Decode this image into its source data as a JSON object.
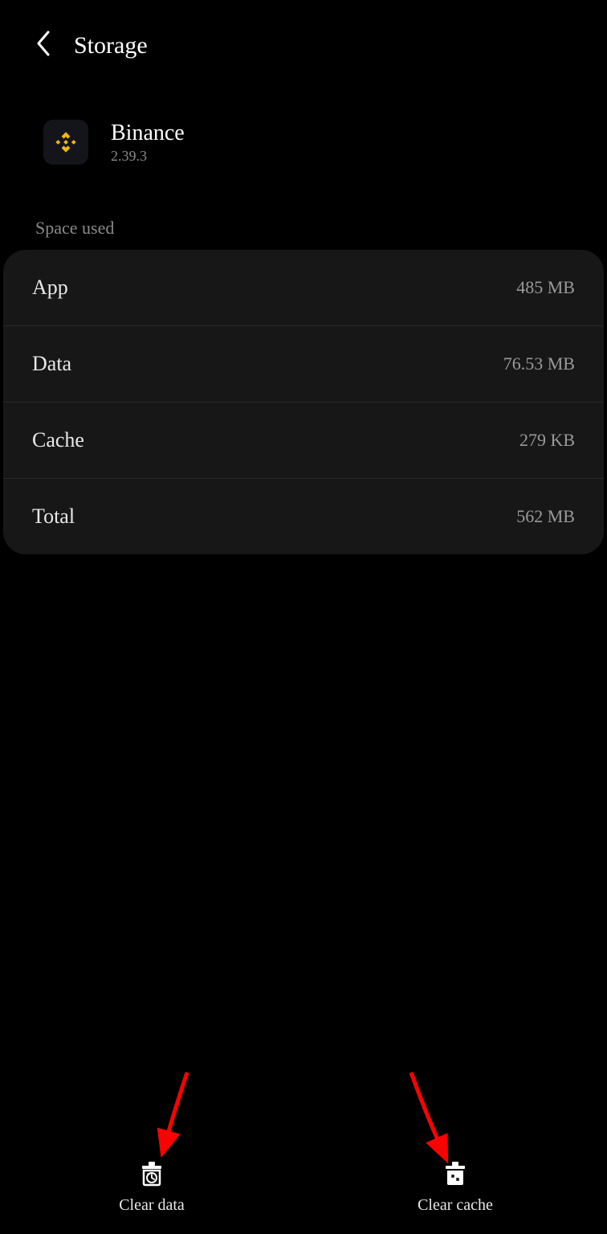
{
  "header": {
    "title": "Storage"
  },
  "app": {
    "name": "Binance",
    "version": "2.39.3"
  },
  "section": {
    "label": "Space used"
  },
  "storage": {
    "app": {
      "label": "App",
      "value": "485 MB"
    },
    "data": {
      "label": "Data",
      "value": "76.53 MB"
    },
    "cache": {
      "label": "Cache",
      "value": "279 KB"
    },
    "total": {
      "label": "Total",
      "value": "562 MB"
    }
  },
  "actions": {
    "clearData": "Clear data",
    "clearCache": "Clear cache"
  }
}
